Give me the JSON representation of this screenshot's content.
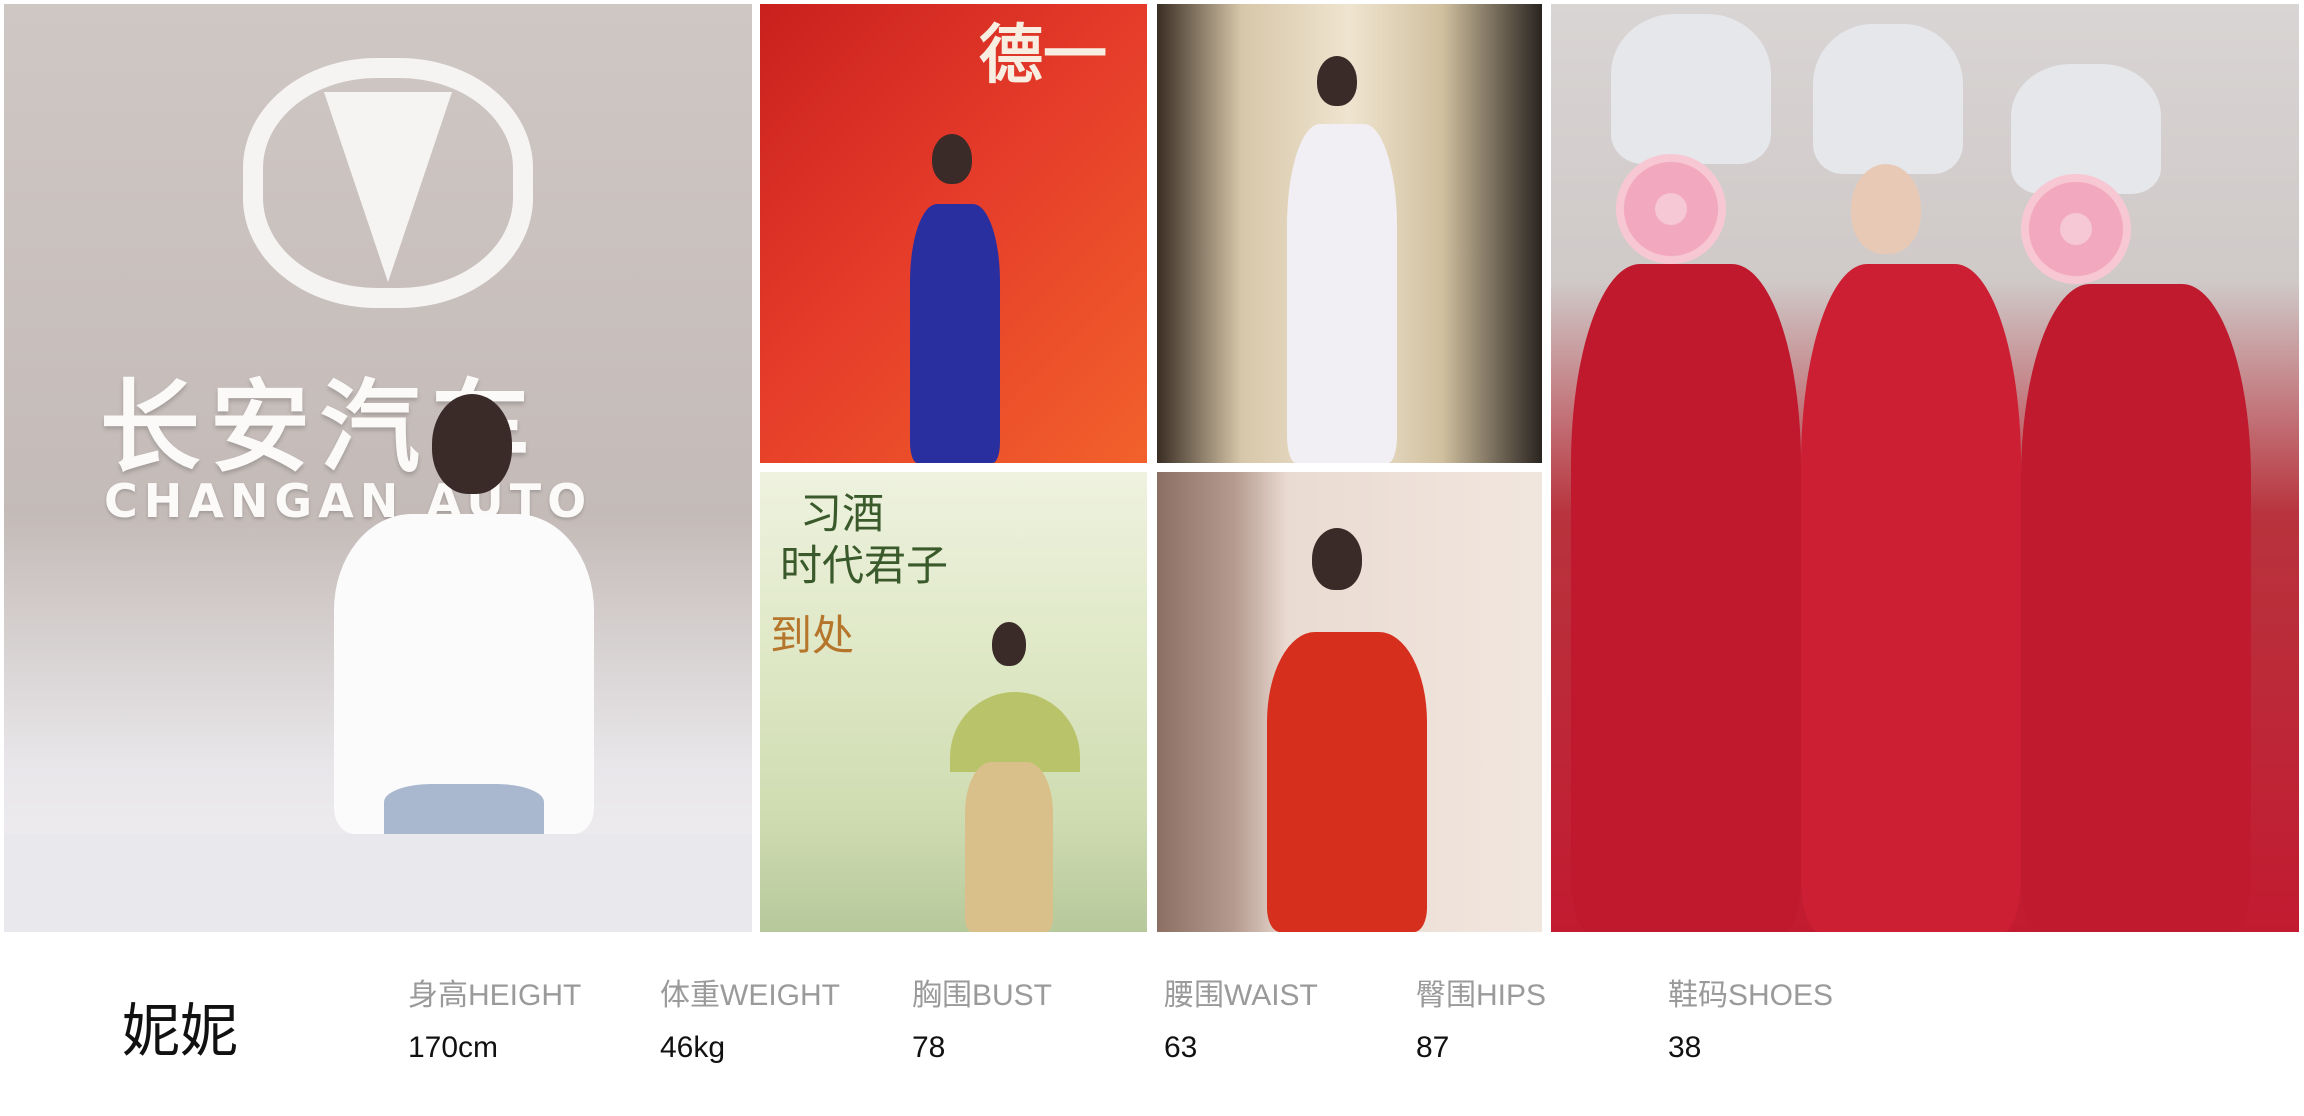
{
  "photos": {
    "p1_brand_zh": "长安汽车",
    "p1_brand_en": "CHANGAN AUTO",
    "p2_title": "德一",
    "p4_line1": "习酒",
    "p4_line2": "时代君子",
    "p4_line3": "到处"
  },
  "profile": {
    "name": "妮妮",
    "stats": [
      {
        "label": "身高HEIGHT",
        "value": "170cm"
      },
      {
        "label": "体重WEIGHT",
        "value": "46kg"
      },
      {
        "label": "胸围BUST",
        "value": "78"
      },
      {
        "label": "腰围WAIST",
        "value": "63"
      },
      {
        "label": "臀围HIPS",
        "value": "87"
      },
      {
        "label": "鞋码SHOES",
        "value": "38"
      }
    ]
  }
}
